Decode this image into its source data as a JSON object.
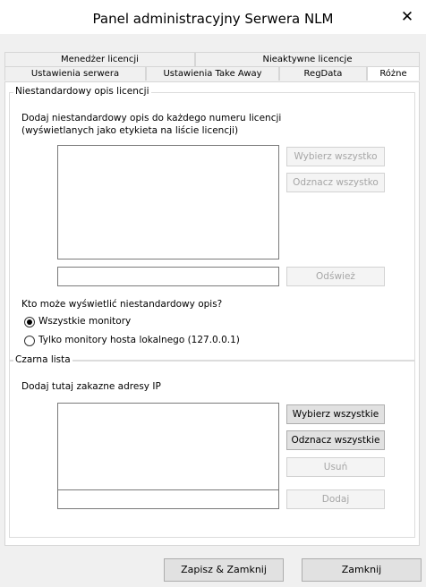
{
  "window": {
    "title": "Panel administracyjny Serwera NLM",
    "close_glyph": "✕"
  },
  "tabs_top": [
    "Menedżer licencji",
    "Nieaktywne licencje"
  ],
  "tabs_bottom": [
    "Ustawienia serwera",
    "Ustawienia Take Away",
    "RegData",
    "Różne"
  ],
  "custom_desc": {
    "legend": "Niestandardowy opis licencji",
    "help_line1": "Dodaj niestandardowy opis do każdego numeru licencji",
    "help_line2": "(wyświetlanych jako etykieta na liście licencji)",
    "select_all": "Wybierz wszystko",
    "deselect_all": "Odznacz wszystko",
    "refresh": "Odśwież",
    "text_value": "",
    "question": "Kto może wyświetlić niestandardowy opis?",
    "radio_all": "Wszystkie monitory",
    "radio_local": "Tylko monitory hosta lokalnego (127.0.0.1)"
  },
  "blacklist": {
    "legend": "Czarna lista",
    "help": "Dodaj tutaj zakazne adresy IP",
    "select_all": "Wybierz wszystkie",
    "deselect_all": "Odznacz wszystkie",
    "remove": "Usuń",
    "add": "Dodaj",
    "text_value": ""
  },
  "footer": {
    "save_close": "Zapisz & Zamknij",
    "close": "Zamknij"
  }
}
